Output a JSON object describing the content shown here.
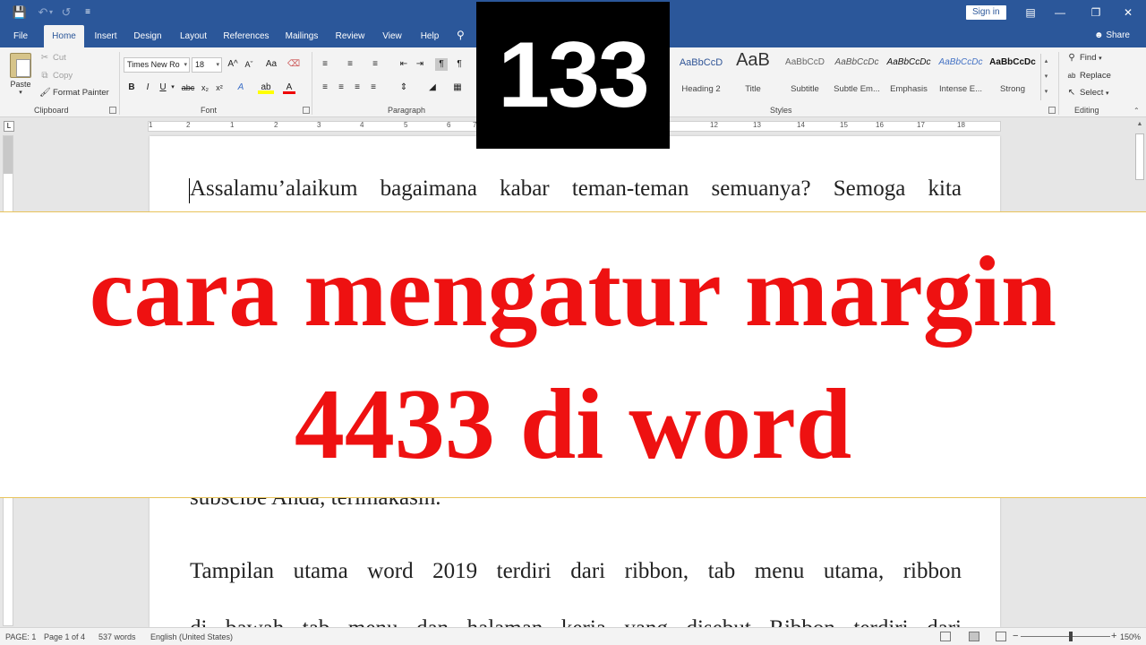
{
  "titlebar": {
    "signin_label": "Sign in",
    "quick_access_icons": [
      "save-icon",
      "undo-icon",
      "redo-icon",
      "customize-icon"
    ]
  },
  "tabs": [
    {
      "label": "File"
    },
    {
      "label": "Home"
    },
    {
      "label": "Insert"
    },
    {
      "label": "Design"
    },
    {
      "label": "Layout"
    },
    {
      "label": "References"
    },
    {
      "label": "Mailings"
    },
    {
      "label": "Review"
    },
    {
      "label": "View"
    },
    {
      "label": "Help"
    }
  ],
  "active_tab": "Home",
  "share_label": "Share",
  "ribbon": {
    "clipboard": {
      "paste_label": "Paste",
      "cut_label": "Cut",
      "copy_label": "Copy",
      "format_painter_label": "Format Painter",
      "group_label": "Clipboard"
    },
    "font": {
      "font_name": "Times New Ro",
      "font_size": "18",
      "group_label": "Font",
      "bold": "B",
      "italic": "I",
      "underline": "U",
      "strike": "abc",
      "subscript": "x₂",
      "superscript": "x²",
      "grow": "A^",
      "shrink": "Aˇ",
      "case": "Aa",
      "font_color_letter": "A",
      "highlight_letter": "ab",
      "effects_letter": "A"
    },
    "paragraph": {
      "group_label": "Paragraph"
    },
    "styles": {
      "group_label": "Styles",
      "items": [
        {
          "preview": "AaBbCcD",
          "name": "Heading 2"
        },
        {
          "preview": "AaB",
          "name": "Title"
        },
        {
          "preview": "AaBbCcD",
          "name": "Subtitle"
        },
        {
          "preview": "AaBbCcDc",
          "name": "Subtle Em..."
        },
        {
          "preview": "AaBbCcDc",
          "name": "Emphasis"
        },
        {
          "preview": "AaBbCcDc",
          "name": "Intense E..."
        },
        {
          "preview": "AaBbCcDc",
          "name": "Strong"
        }
      ]
    },
    "editing": {
      "find_label": "Find",
      "replace_label": "Replace",
      "select_label": "Select",
      "group_label": "Editing"
    }
  },
  "badge_number": "133",
  "ruler_numbers": [
    "1",
    "2",
    "1",
    "1",
    "2",
    "3",
    "4",
    "5",
    "6",
    "7",
    "12",
    "13",
    "14",
    "15",
    "16",
    "17",
    "18"
  ],
  "document": {
    "line1": "Assalamu’alaikum bagaimana kabar teman-teman semuanya? Semoga kita",
    "line2": "subscibe Anda, terimakasih.",
    "line3": "Tampilan utama word 2019 terdiri dari ribbon, tab menu utama, ribbon",
    "line4": "di bawah tab menu dan halaman kerja yang disebut Ribbon terdiri dari"
  },
  "banner": {
    "line1": "cara mengatur margin",
    "line2": "4433 di word",
    "color": "#ee1111"
  },
  "statusbar": {
    "page": "PAGE: 1",
    "page_of": "Page 1 of 4",
    "words": "537 words",
    "language": "English (United States)",
    "zoom": "150%",
    "zoom_minus": "−",
    "zoom_plus": "+"
  },
  "colors": {
    "accent": "#2b579a",
    "ribbon_bg": "#f3f3f3",
    "banner_border": "#e8c35a"
  }
}
